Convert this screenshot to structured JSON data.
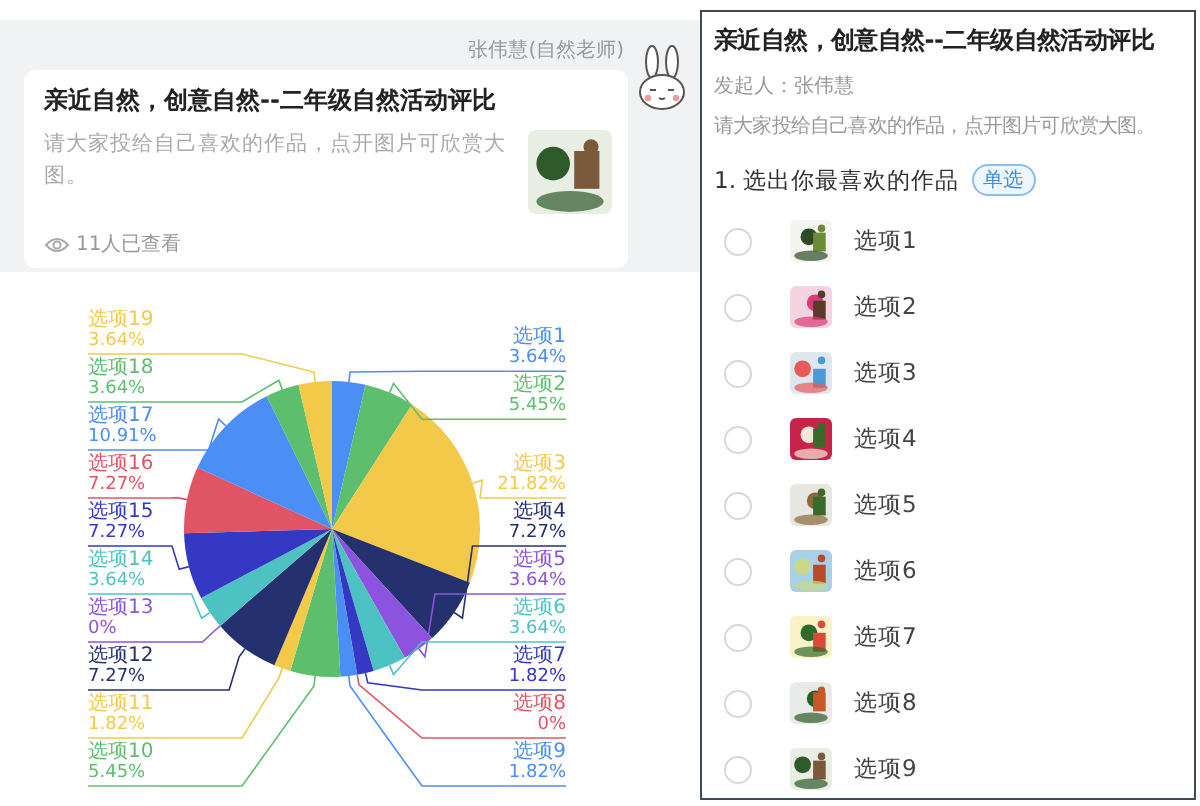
{
  "chat": {
    "sender": "张伟慧(自然老师)",
    "card": {
      "title": "亲近自然，创意自然--二年级自然活动评比",
      "description": "请大家投给自己喜欢的作品，点开图片可欣赏大图。",
      "views": "11人已查看"
    }
  },
  "chart_data": {
    "type": "pie",
    "categories": [
      "选项1",
      "选项2",
      "选项3",
      "选项4",
      "选项5",
      "选项6",
      "选项7",
      "选项8",
      "选项9",
      "选项10",
      "选项11",
      "选项12",
      "选项13",
      "选项14",
      "选项15",
      "选项16",
      "选项17",
      "选项18",
      "选项19"
    ],
    "values": [
      3.64,
      5.45,
      21.82,
      7.27,
      3.64,
      3.64,
      1.82,
      0,
      1.82,
      5.45,
      1.82,
      7.27,
      0,
      3.64,
      7.27,
      7.27,
      10.91,
      3.64,
      3.64
    ],
    "value_labels": [
      "3.64%",
      "5.45%",
      "21.82%",
      "7.27%",
      "3.64%",
      "3.64%",
      "1.82%",
      "0%",
      "1.82%",
      "5.45%",
      "1.82%",
      "7.27%",
      "0%",
      "3.64%",
      "7.27%",
      "7.27%",
      "10.91%",
      "3.64%",
      "3.64%"
    ]
  },
  "survey": {
    "title": "亲近自然，创意自然--二年级自然活动评比",
    "initiator": "发起人：张伟慧",
    "description": "请大家投给自己喜欢的作品，点开图片可欣赏大图。",
    "question": {
      "text": "1. 选出你最喜欢的作品",
      "badge": "单选",
      "options": [
        {
          "label": "选项1",
          "selected": false
        },
        {
          "label": "选项2",
          "selected": false
        },
        {
          "label": "选项3",
          "selected": false
        },
        {
          "label": "选项4",
          "selected": false
        },
        {
          "label": "选项5",
          "selected": false
        },
        {
          "label": "选项6",
          "selected": false
        },
        {
          "label": "选项7",
          "selected": false
        },
        {
          "label": "选项8",
          "selected": false
        },
        {
          "label": "选项9",
          "selected": false
        }
      ]
    }
  }
}
